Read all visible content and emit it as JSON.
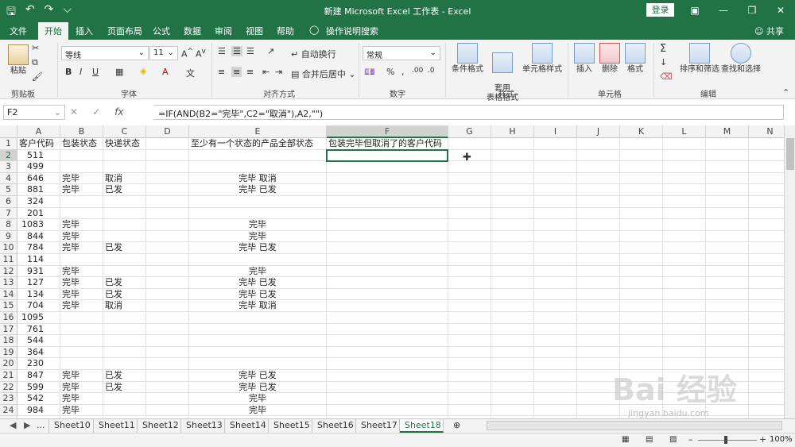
{
  "title": "新建 Microsoft Excel 工作表  -  Excel",
  "login": "登录",
  "tabs": [
    "文件",
    "开始",
    "插入",
    "页面布局",
    "公式",
    "数据",
    "审阅",
    "视图",
    "帮助",
    "操作说明搜索"
  ],
  "share": "共享",
  "ribbon": {
    "paste": "粘贴",
    "clipboard": "剪贴板",
    "font_name": "等线",
    "font_size": "11",
    "font_group": "字体",
    "wrap_text": "自动换行",
    "merge_center": "合并后居中",
    "alignment_group": "对齐方式",
    "number_format": "常规",
    "number_group": "数字",
    "cond_format": "条件格式",
    "table_format": "套用\n表格格式",
    "cell_style": "单元格样式",
    "styles_group": "样式",
    "insert": "插入",
    "delete": "删除",
    "format": "格式",
    "cells_group": "单元格",
    "sort_filter": "排序和筛选",
    "find_select": "查找和选择",
    "editing_group": "编辑"
  },
  "namebox": "F2",
  "formula": "=IF(AND(B2=\"完毕\",C2=\"取消\"),A2,\"\")",
  "columns": [
    "A",
    "B",
    "C",
    "D",
    "E",
    "F",
    "G",
    "H",
    "I",
    "J",
    "K",
    "L",
    "M",
    "N"
  ],
  "rows": [
    [
      "客户代码",
      "包装状态",
      "快递状态",
      "",
      "至少有一个状态的产品全部状态",
      "包装完毕但取消了的客户代码"
    ],
    [
      "511",
      "",
      "",
      "",
      "",
      ""
    ],
    [
      "499",
      "",
      "",
      "",
      "",
      ""
    ],
    [
      "646",
      "完毕",
      "取消",
      "",
      "完毕 取消",
      ""
    ],
    [
      "881",
      "完毕",
      "已发",
      "",
      "完毕 已发",
      ""
    ],
    [
      "324",
      "",
      "",
      "",
      "",
      ""
    ],
    [
      "201",
      "",
      "",
      "",
      "",
      ""
    ],
    [
      "1083",
      "完毕",
      "",
      "",
      "完毕",
      ""
    ],
    [
      "844",
      "完毕",
      "",
      "",
      "完毕",
      ""
    ],
    [
      "784",
      "完毕",
      "已发",
      "",
      "完毕 已发",
      ""
    ],
    [
      "114",
      "",
      "",
      "",
      "",
      ""
    ],
    [
      "931",
      "完毕",
      "",
      "",
      "完毕",
      ""
    ],
    [
      "127",
      "完毕",
      "已发",
      "",
      "完毕 已发",
      ""
    ],
    [
      "134",
      "完毕",
      "已发",
      "",
      "完毕 已发",
      ""
    ],
    [
      "704",
      "完毕",
      "取消",
      "",
      "完毕 取消",
      ""
    ],
    [
      "1095",
      "",
      "",
      "",
      "",
      ""
    ],
    [
      "761",
      "",
      "",
      "",
      "",
      ""
    ],
    [
      "544",
      "",
      "",
      "",
      "",
      ""
    ],
    [
      "364",
      "",
      "",
      "",
      "",
      ""
    ],
    [
      "230",
      "",
      "",
      "",
      "",
      ""
    ],
    [
      "847",
      "完毕",
      "已发",
      "",
      "完毕 已发",
      ""
    ],
    [
      "599",
      "完毕",
      "已发",
      "",
      "完毕 已发",
      ""
    ],
    [
      "542",
      "完毕",
      "",
      "",
      "完毕",
      ""
    ],
    [
      "984",
      "完毕",
      "",
      "",
      "完毕",
      ""
    ]
  ],
  "sheets": [
    "...",
    "Sheet10",
    "Sheet11",
    "Sheet12",
    "Sheet13",
    "Sheet14",
    "Sheet15",
    "Sheet16",
    "Sheet17",
    "Sheet18"
  ],
  "active_sheet": "Sheet18",
  "zoom": "100%",
  "watermark": "Bai 经验",
  "watermark_url": "jingyan.baidu.com"
}
